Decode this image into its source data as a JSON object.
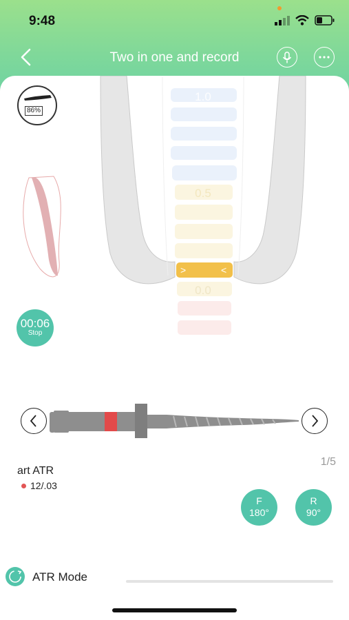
{
  "status_bar": {
    "time": "9:48"
  },
  "nav": {
    "title": "Two in one and record"
  },
  "battery": {
    "percent": "86%"
  },
  "scale": {
    "labels": {
      "top": "1.0",
      "mid": "0.5",
      "zero": "0.0"
    },
    "active": {
      "left": ">",
      "right": "<"
    }
  },
  "timer": {
    "time": "00:06",
    "action": "Stop"
  },
  "file": {
    "name": "art ATR",
    "size": "12/.03",
    "page": "1/5"
  },
  "angles": {
    "forward": {
      "label": "F",
      "value": "180°"
    },
    "reverse": {
      "label": "R",
      "value": "90°"
    }
  },
  "mode": {
    "label": "ATR Mode"
  },
  "colors": {
    "accent": "#52c4aa",
    "header_top": "#9be08c",
    "header_bottom": "#6fd3a2",
    "active_segment": "#f2c04a",
    "file_ring": "#e24a4a"
  },
  "icons": [
    "back-icon",
    "microphone-icon",
    "more-icon",
    "tooth-icon",
    "prev-icon",
    "next-icon",
    "atr-mode-icon"
  ]
}
